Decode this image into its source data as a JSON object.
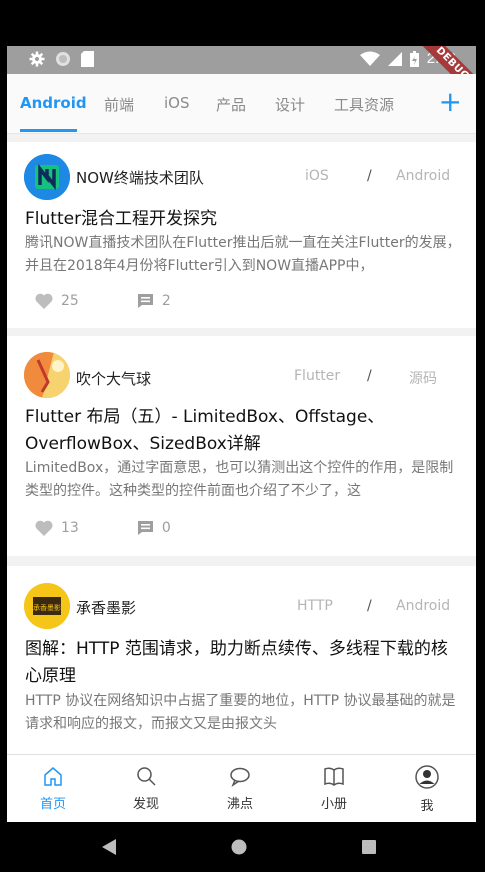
{
  "status_bar": {
    "time": "2:33",
    "debug_label": "DEBUG"
  },
  "tabs": [
    {
      "label": "Android",
      "active": true
    },
    {
      "label": "前端"
    },
    {
      "label": "iOS"
    },
    {
      "label": "产品"
    },
    {
      "label": "设计"
    },
    {
      "label": "工具资源"
    }
  ],
  "add_label": "+",
  "cards": [
    {
      "author": "NOW终端技术团队",
      "tag1": "iOS",
      "slash": "/",
      "tag2": "Android",
      "title": "Flutter混合工程开发探究",
      "desc": "腾讯NOW直播技术团队在Flutter推出后就一直在关注Flutter的发展，并且在2018年4月份将Flutter引入到NOW直播APP中，",
      "likes": "25",
      "comments": "2"
    },
    {
      "author": "吹个大气球",
      "tag1": "Flutter",
      "slash": "/",
      "tag2": "源码",
      "title": "Flutter 布局（五）- LimitedBox、Offstage、OverflowBox、SizedBox详解",
      "desc": "LimitedBox，通过字面意思，也可以猜测出这个控件的作用，是限制类型的控件。这种类型的控件前面也介绍了不少了，这",
      "likes": "13",
      "comments": "0"
    },
    {
      "author": "承香墨影",
      "tag1": "HTTP",
      "slash": "/",
      "tag2": "Android",
      "title": "图解：HTTP 范围请求，助力断点续传、多线程下载的核心原理",
      "desc": "HTTP 协议在网络知识中占据了重要的地位，HTTP 协议最基础的就是请求和响应的报文，而报文又是由报文头",
      "avatar_text": "承香墨影"
    }
  ],
  "bottom_nav": [
    {
      "label": "首页",
      "icon": "home-icon",
      "active": true
    },
    {
      "label": "发现",
      "icon": "search-icon"
    },
    {
      "label": "沸点",
      "icon": "chat-bubble-icon"
    },
    {
      "label": "小册",
      "icon": "book-icon"
    },
    {
      "label": "我",
      "icon": "profile-icon"
    }
  ],
  "colors": {
    "accent": "#2196f3",
    "statusbar": "#9e9e9e",
    "background": "#f2f2f2"
  }
}
